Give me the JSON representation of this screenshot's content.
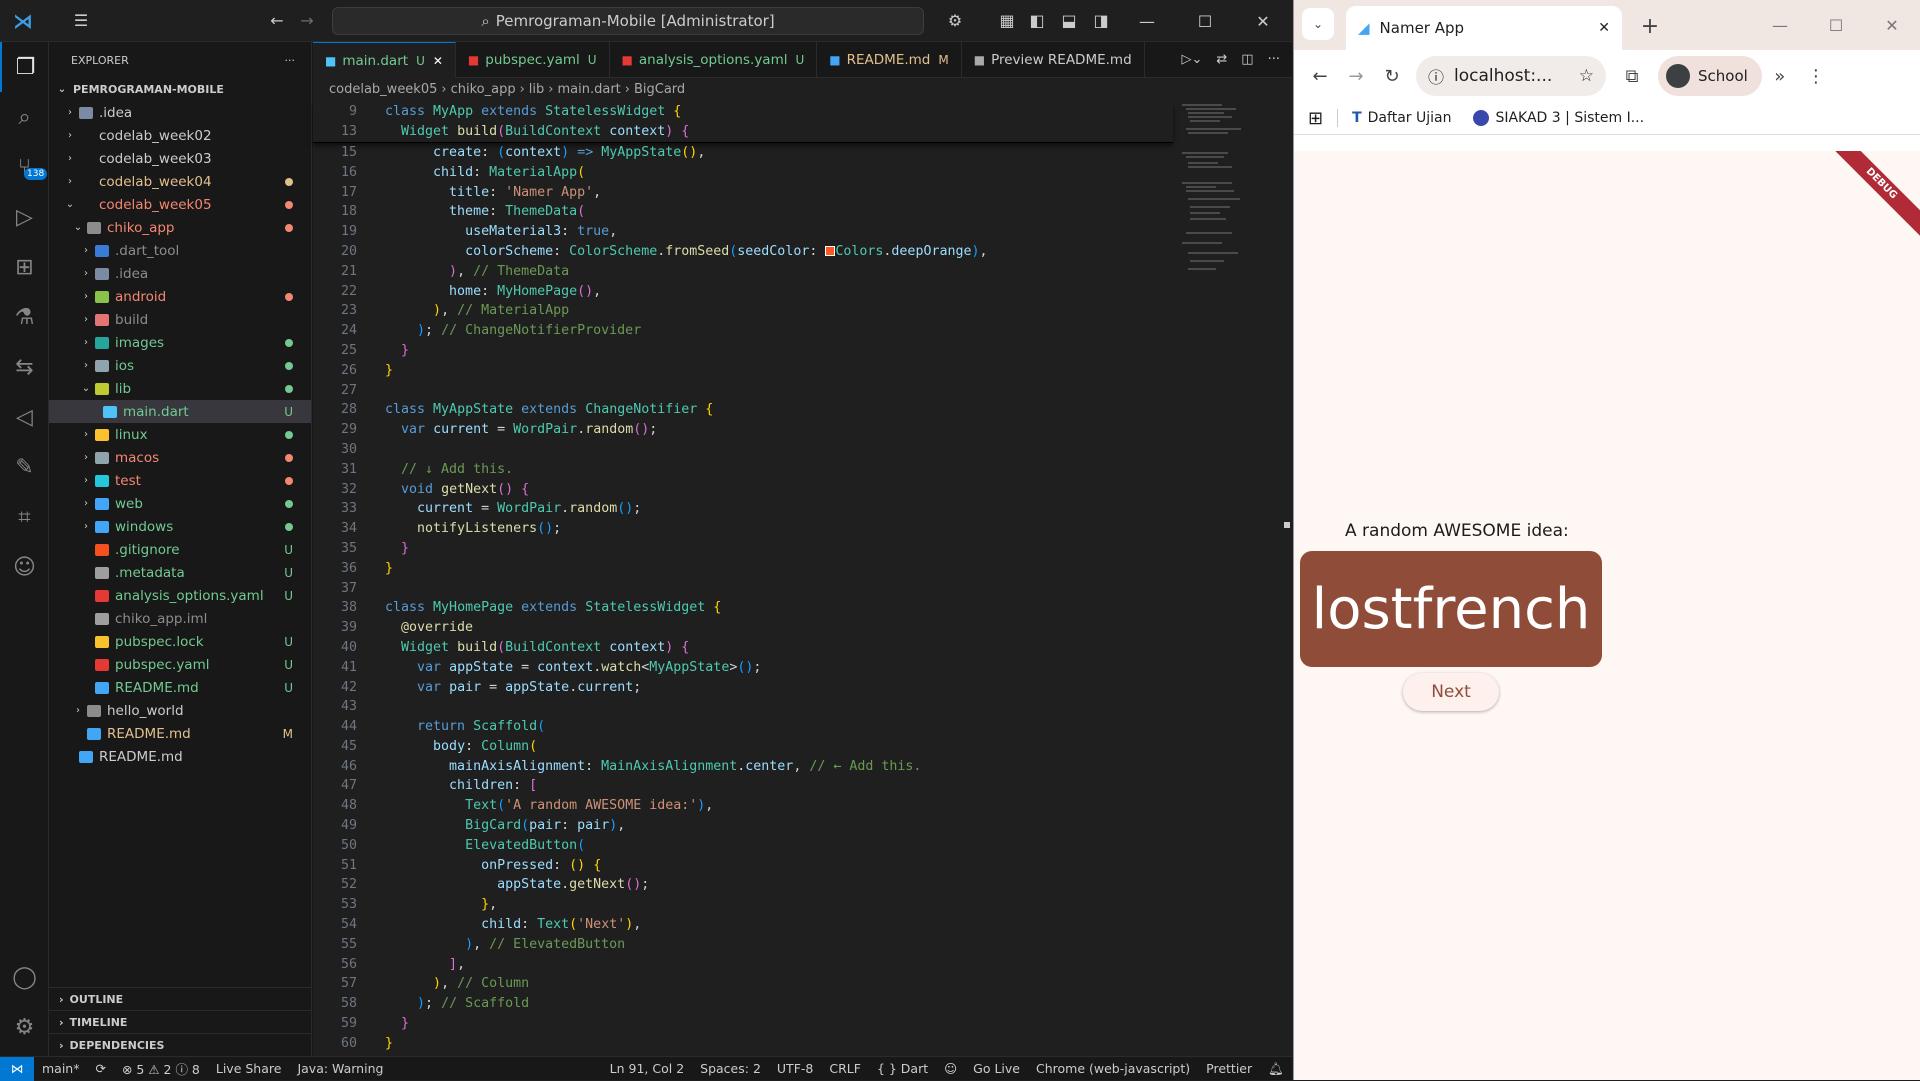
{
  "vscode": {
    "title": "Pemrograman-Mobile [Administrator]",
    "sidebar": {
      "header": "EXPLORER",
      "root": "PEMROGRAMAN-MOBILE",
      "items": [
        {
          "label": ".idea",
          "depth": 1,
          "color": "#ccc",
          "icon": "#7b8ba4",
          "status": "",
          "chev": "›"
        },
        {
          "label": "codelab_week02",
          "depth": 1,
          "color": "#ccc",
          "icon": "",
          "status": "",
          "chev": "›"
        },
        {
          "label": "codelab_week03",
          "depth": 1,
          "color": "#ccc",
          "icon": "",
          "status": "",
          "chev": "›"
        },
        {
          "label": "codelab_week04",
          "depth": 1,
          "color": "#e2c08d",
          "icon": "",
          "status": "dot:#e2c08d",
          "chev": "›"
        },
        {
          "label": "codelab_week05",
          "depth": 1,
          "color": "#f48771",
          "icon": "",
          "status": "dot:#f48771",
          "chev": "⌄"
        },
        {
          "label": "chiko_app",
          "depth": 2,
          "color": "#f48771",
          "icon": "#8c8c8c",
          "status": "dot:#f48771",
          "chev": "⌄"
        },
        {
          "label": ".dart_tool",
          "depth": 3,
          "color": "#8c8c8c",
          "icon": "#3a7bd5",
          "status": "",
          "chev": "›"
        },
        {
          "label": ".idea",
          "depth": 3,
          "color": "#8c8c8c",
          "icon": "#7b8ba4",
          "status": "",
          "chev": "›"
        },
        {
          "label": "android",
          "depth": 3,
          "color": "#f48771",
          "icon": "#8bc34a",
          "status": "dot:#f48771",
          "chev": "›"
        },
        {
          "label": "build",
          "depth": 3,
          "color": "#8c8c8c",
          "icon": "#e57373",
          "status": "",
          "chev": "›"
        },
        {
          "label": "images",
          "depth": 3,
          "color": "#73c991",
          "icon": "#26a69a",
          "status": "dot:#73c991",
          "chev": "›"
        },
        {
          "label": "ios",
          "depth": 3,
          "color": "#73c991",
          "icon": "#90a4ae",
          "status": "dot:#73c991",
          "chev": "›"
        },
        {
          "label": "lib",
          "depth": 3,
          "color": "#73c991",
          "icon": "#c0ca33",
          "status": "dot:#73c991",
          "chev": "⌄"
        },
        {
          "label": "main.dart",
          "depth": 4,
          "color": "#73c991",
          "icon": "#4fc3f7",
          "status": "U",
          "chev": "",
          "selected": true
        },
        {
          "label": "linux",
          "depth": 3,
          "color": "#73c991",
          "icon": "#fbc02d",
          "status": "dot:#73c991",
          "chev": "›"
        },
        {
          "label": "macos",
          "depth": 3,
          "color": "#f48771",
          "icon": "#90a4ae",
          "status": "dot:#f48771",
          "chev": "›"
        },
        {
          "label": "test",
          "depth": 3,
          "color": "#f48771",
          "icon": "#26c6da",
          "status": "dot:#f48771",
          "chev": "›"
        },
        {
          "label": "web",
          "depth": 3,
          "color": "#73c991",
          "icon": "#42a5f5",
          "status": "dot:#73c991",
          "chev": "›"
        },
        {
          "label": "windows",
          "depth": 3,
          "color": "#73c991",
          "icon": "#42a5f5",
          "status": "dot:#73c991",
          "chev": "›"
        },
        {
          "label": ".gitignore",
          "depth": 3,
          "color": "#73c991",
          "icon": "#f4511e",
          "status": "U",
          "chev": ""
        },
        {
          "label": ".metadata",
          "depth": 3,
          "color": "#73c991",
          "icon": "#9e9e9e",
          "status": "U",
          "chev": ""
        },
        {
          "label": "analysis_options.yaml",
          "depth": 3,
          "color": "#73c991",
          "icon": "#e53935",
          "status": "U",
          "chev": ""
        },
        {
          "label": "chiko_app.iml",
          "depth": 3,
          "color": "#8c8c8c",
          "icon": "#9e9e9e",
          "status": "",
          "chev": ""
        },
        {
          "label": "pubspec.lock",
          "depth": 3,
          "color": "#73c991",
          "icon": "#fbc02d",
          "status": "U",
          "chev": ""
        },
        {
          "label": "pubspec.yaml",
          "depth": 3,
          "color": "#73c991",
          "icon": "#e53935",
          "status": "U",
          "chev": ""
        },
        {
          "label": "README.md",
          "depth": 3,
          "color": "#73c991",
          "icon": "#42a5f5",
          "status": "U",
          "chev": ""
        },
        {
          "label": "hello_world",
          "depth": 2,
          "color": "#ccc",
          "icon": "#8c8c8c",
          "status": "",
          "chev": "›"
        },
        {
          "label": "README.md",
          "depth": 2,
          "color": "#e2c08d",
          "icon": "#42a5f5",
          "status": "M",
          "chev": ""
        },
        {
          "label": "README.md",
          "depth": 1,
          "color": "#ccc",
          "icon": "#42a5f5",
          "status": "",
          "chev": ""
        }
      ],
      "sections": [
        "OUTLINE",
        "TIMELINE",
        "DEPENDENCIES"
      ]
    },
    "tabs": [
      {
        "label": "main.dart",
        "mark": "U",
        "color": "#73c991",
        "icon": "#4fc3f7",
        "active": true
      },
      {
        "label": "pubspec.yaml",
        "mark": "U",
        "color": "#73c991",
        "icon": "#e53935"
      },
      {
        "label": "analysis_options.yaml",
        "mark": "U",
        "color": "#73c991",
        "icon": "#e53935"
      },
      {
        "label": "README.md",
        "mark": "M",
        "color": "#e2c08d",
        "icon": "#42a5f5"
      },
      {
        "label": "Preview README.md",
        "mark": "",
        "color": "#ccc",
        "icon": "#aaa"
      }
    ],
    "breadcrumb": [
      "codelab_week05",
      "chiko_app",
      "lib",
      "main.dart",
      "BigCard"
    ],
    "sticky_lines": [
      {
        "n": "9",
        "html": "<span class='k'>class</span> <span class='t'>MyApp</span> <span class='k'>extends</span> <span class='t'>StatelessWidget</span> <span class='y'>{</span>"
      },
      {
        "n": "13",
        "html": "  <span class='t'>Widget</span> <span class='f'>build</span><span class='m'>(</span><span class='t'>BuildContext</span> <span class='p'>context</span><span class='m'>)</span> <span class='m'>{</span>"
      }
    ],
    "code_lines": [
      {
        "n": "15",
        "html": "      <span class='p'>create</span>: <span class='b'>(</span><span class='p'>context</span><span class='b'>)</span> <span class='k'>=&gt;</span> <span class='t'>MyAppState</span><span class='y'>()</span>,"
      },
      {
        "n": "16",
        "html": "      <span class='p'>child</span>: <span class='t'>MaterialApp</span><span class='y'>(</span>"
      },
      {
        "n": "17",
        "html": "        <span class='p'>title</span>: <span class='s'>'Namer App'</span>,"
      },
      {
        "n": "18",
        "html": "        <span class='p'>theme</span>: <span class='t'>ThemeData</span><span class='m'>(</span>"
      },
      {
        "n": "19",
        "html": "          <span class='p'>useMaterial3</span>: <span class='k'>true</span>,"
      },
      {
        "n": "20",
        "html": "          <span class='p'>colorScheme</span>: <span class='t'>ColorScheme</span>.<span class='f'>fromSeed</span><span class='b'>(</span><span class='p'>seedColor</span>: <span style='display:inline-block;width:10px;height:10px;background:#ff5722;border:1px solid #fff;vertical-align:middle'></span><span class='t'>Colors</span>.<span class='p'>deepOrange</span><span class='b'>)</span>,"
      },
      {
        "n": "21",
        "html": "        <span class='m'>)</span>, <span class='c'>// ThemeData</span>"
      },
      {
        "n": "22",
        "html": "        <span class='p'>home</span>: <span class='t'>MyHomePage</span><span class='m'>()</span>,"
      },
      {
        "n": "23",
        "html": "      <span class='y'>)</span>, <span class='c'>// MaterialApp</span>"
      },
      {
        "n": "24",
        "html": "    <span class='b'>)</span>; <span class='c'>// ChangeNotifierProvider</span>"
      },
      {
        "n": "25",
        "html": "  <span class='m'>}</span>"
      },
      {
        "n": "26",
        "html": "<span class='y'>}</span>"
      },
      {
        "n": "27",
        "html": ""
      },
      {
        "n": "28",
        "html": "<span class='k'>class</span> <span class='t'>MyAppState</span> <span class='k'>extends</span> <span class='t'>ChangeNotifier</span> <span class='y'>{</span>"
      },
      {
        "n": "29",
        "html": "  <span class='k'>var</span> <span class='p'>current</span> = <span class='t'>WordPair</span>.<span class='f'>random</span><span class='m'>()</span>;"
      },
      {
        "n": "30",
        "html": ""
      },
      {
        "n": "31",
        "html": "  <span class='c'>// ↓ Add this.</span>"
      },
      {
        "n": "32",
        "html": "  <span class='k'>void</span> <span class='f'>getNext</span><span class='m'>()</span> <span class='m'>{</span>"
      },
      {
        "n": "33",
        "html": "    <span class='p'>current</span> = <span class='t'>WordPair</span>.<span class='f'>random</span><span class='b'>()</span>;"
      },
      {
        "n": "34",
        "html": "    <span class='f'>notifyListeners</span><span class='b'>()</span>;"
      },
      {
        "n": "35",
        "html": "  <span class='m'>}</span>"
      },
      {
        "n": "36",
        "html": "<span class='y'>}</span>"
      },
      {
        "n": "37",
        "html": ""
      },
      {
        "n": "38",
        "html": "<span class='k'>class</span> <span class='t'>MyHomePage</span> <span class='k'>extends</span> <span class='t'>StatelessWidget</span> <span class='y'>{</span>"
      },
      {
        "n": "39",
        "html": "  <span class='f'>@override</span>"
      },
      {
        "n": "40",
        "html": "  <span class='t'>Widget</span> <span class='f'>build</span><span class='m'>(</span><span class='t'>BuildContext</span> <span class='p'>context</span><span class='m'>)</span> <span class='m'>{</span>"
      },
      {
        "n": "41",
        "html": "    <span class='k'>var</span> <span class='p'>appState</span> = <span class='p'>context</span>.<span class='f'>watch</span>&lt;<span class='t'>MyAppState</span>&gt;<span class='b'>()</span>;"
      },
      {
        "n": "42",
        "html": "    <span class='k'>var</span> <span class='p'>pair</span> = <span class='p'>appState</span>.<span class='p'>current</span>;"
      },
      {
        "n": "43",
        "html": ""
      },
      {
        "n": "44",
        "html": "    <span class='k'>return</span> <span class='t'>Scaffold</span><span class='b'>(</span>"
      },
      {
        "n": "45",
        "html": "      <span class='p'>body</span>: <span class='t'>Column</span><span class='y'>(</span>"
      },
      {
        "n": "46",
        "html": "        <span class='p'>mainAxisAlignment</span>: <span class='t'>MainAxisAlignment</span>.<span class='p'>center</span>, <span class='c'>// ← Add this.</span>"
      },
      {
        "n": "47",
        "html": "        <span class='p'>children</span>: <span class='m'>[</span>"
      },
      {
        "n": "48",
        "html": "          <span class='t'>Text</span><span class='b'>(</span><span class='s'>'A random AWESOME idea:'</span><span class='b'>)</span>,"
      },
      {
        "n": "49",
        "html": "          <span class='t'>BigCard</span><span class='b'>(</span><span class='p'>pair</span>: <span class='p'>pair</span><span class='b'>)</span>,"
      },
      {
        "n": "50",
        "html": "          <span class='t'>ElevatedButton</span><span class='b'>(</span>"
      },
      {
        "n": "51",
        "html": "            <span class='p'>onPressed</span>: <span class='y'>()</span> <span class='y'>{</span>"
      },
      {
        "n": "52",
        "html": "              <span class='p'>appState</span>.<span class='f'>getNext</span><span class='m'>()</span>;"
      },
      {
        "n": "53",
        "html": "            <span class='y'>}</span>,"
      },
      {
        "n": "54",
        "html": "            <span class='p'>child</span>: <span class='t'>Text</span><span class='y'>(</span><span class='s'>'Next'</span><span class='y'>)</span>,"
      },
      {
        "n": "55",
        "html": "          <span class='b'>)</span>, <span class='c'>// ElevatedButton</span>"
      },
      {
        "n": "56",
        "html": "        <span class='m'>]</span>,"
      },
      {
        "n": "57",
        "html": "      <span class='y'>)</span>, <span class='c'>// Column</span>"
      },
      {
        "n": "58",
        "html": "    <span class='b'>)</span>; <span class='c'>// Scaffold</span>"
      },
      {
        "n": "59",
        "html": "  <span class='m'>}</span>"
      },
      {
        "n": "60",
        "html": "<span class='y'>}</span>"
      }
    ],
    "status": {
      "branch": "main*",
      "problems": "⊗ 5 ⚠ 2 ⓘ 8",
      "live_share": "Live Share",
      "java": "Java: Warning",
      "position": "Ln 91, Col 2",
      "spaces": "Spaces: 2",
      "encoding": "UTF-8",
      "eol": "CRLF",
      "language": "{ } Dart",
      "go_live": "Go Live",
      "device": "Chrome (web-javascript)",
      "prettier": "Prettier"
    },
    "activity_badge": "138"
  },
  "chrome": {
    "tab_title": "Namer App",
    "url": "localhost:...",
    "profile": "School",
    "bookmarks": [
      "Daftar Ujian",
      "SIAKAD 3 | Sistem I..."
    ],
    "debug_banner": "DEBUG",
    "app": {
      "label": "A random AWESOME idea:",
      "word": "lostfrench",
      "button": "Next"
    }
  }
}
